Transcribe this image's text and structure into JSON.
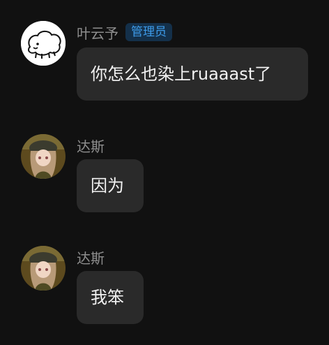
{
  "messages": [
    {
      "sender": "叶云予",
      "badge": "管理员",
      "text": "你怎么也染上ruaaast了",
      "avatar_icon": "sheep-doodle-icon"
    },
    {
      "sender": "达斯",
      "badge": "",
      "text": "因为",
      "avatar_icon": "anime-girl-avatar"
    },
    {
      "sender": "达斯",
      "badge": "",
      "text": "我笨",
      "avatar_icon": "anime-girl-avatar"
    }
  ],
  "colors": {
    "background": "#111111",
    "bubble": "#2a2a2a",
    "name": "#8e8e8e",
    "badge_bg": "#14304a",
    "badge_text": "#3d9be9"
  }
}
